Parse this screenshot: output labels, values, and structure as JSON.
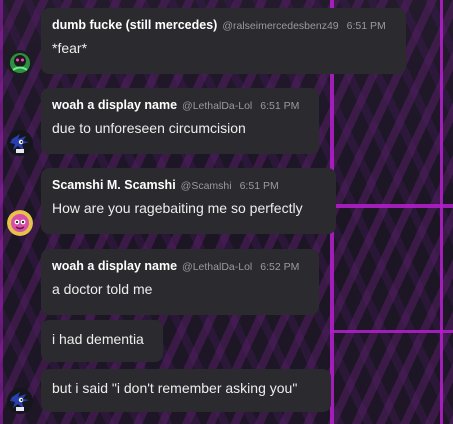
{
  "messages": [
    {
      "username": "dumb fucke (still mercedes)",
      "handle": "@ralseimercedesbenz49",
      "time": "6:51 PM",
      "text": "*fear*"
    },
    {
      "username": "woah a display name",
      "handle": "@LethalDa-Lol",
      "time": "6:51 PM",
      "text": "due to unforeseen circumcision"
    },
    {
      "username": "Scamshi M. Scamshi",
      "handle": "@Scamshi",
      "time": "6:51 PM",
      "text": "How are you ragebaiting me so perfectly"
    },
    {
      "username": "woah a display name",
      "handle": "@LethalDa-Lol",
      "time": "6:52 PM",
      "text": "a doctor told me"
    },
    {
      "text": "i had dementia"
    },
    {
      "text": "but i said \"i don't remember asking you\""
    }
  ],
  "avatars": {
    "ralsei": {
      "icon": "green-creature-avatar-icon",
      "color": "#3fbf5a"
    },
    "lethal": {
      "icon": "blue-hedgehog-avatar-icon",
      "color": "#2a3fae"
    },
    "scamshi": {
      "icon": "yellow-pink-avatar-icon",
      "color": "#e6c34a"
    }
  }
}
